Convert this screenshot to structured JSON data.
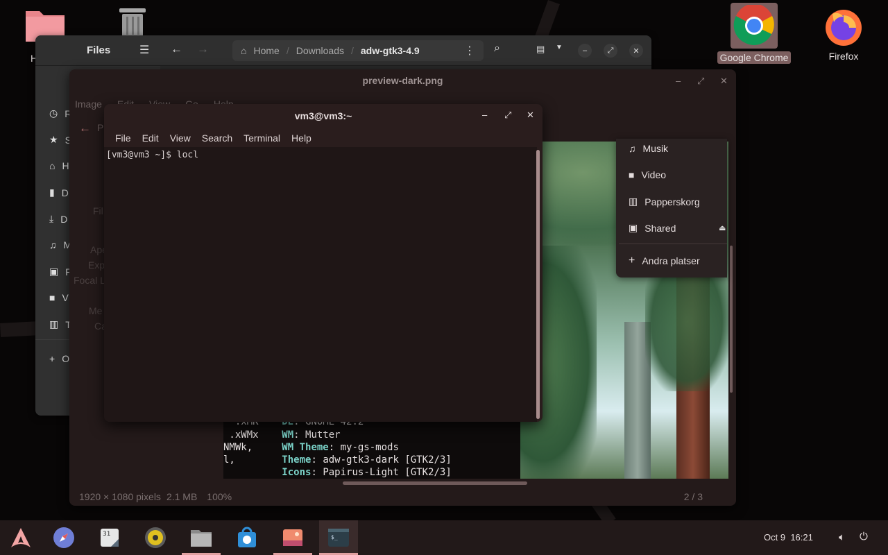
{
  "desktop": {
    "icons": [
      {
        "label": "H",
        "icon": "home-folder-icon"
      },
      {
        "label": "",
        "icon": "trash-icon"
      },
      {
        "label": "Google Chrome",
        "icon": "chrome-icon"
      },
      {
        "label": "Firefox",
        "icon": "firefox-icon"
      }
    ]
  },
  "files": {
    "title": "Files",
    "breadcrumb": [
      "Home",
      "Downloads",
      "adw-gtk3-4.9"
    ],
    "sidebar_letters": [
      "R",
      "S",
      "H",
      "D",
      "D",
      "M",
      "P",
      "V",
      "T",
      "O"
    ]
  },
  "image_viewer": {
    "title": "preview-dark.png",
    "menu": [
      "Image",
      "Edit",
      "View",
      "Go",
      "Help"
    ],
    "status": {
      "dimensions": "1920 × 1080 pixels",
      "size": "2.1 MB",
      "zoom": "100%"
    },
    "page": "2 / 3",
    "ghost_labels": [
      "P",
      "Fil",
      "Ape",
      "Exp",
      "Focal L",
      "Me",
      "Ca"
    ]
  },
  "places_popup": {
    "items": [
      {
        "label": "Musik",
        "icon": "music-note-icon"
      },
      {
        "label": "Video",
        "icon": "video-camera-icon"
      },
      {
        "label": "Papperskorg",
        "icon": "trash-icon"
      },
      {
        "label": "Shared",
        "icon": "shared-drive-icon"
      },
      {
        "label": "Andra platser",
        "icon": "plus-icon"
      }
    ]
  },
  "neofetch": {
    "rows": [
      {
        "art": "  .xMK  ",
        "key": "DE",
        "value": "GNOME 42.2"
      },
      {
        "art": " .xWMx  ",
        "key": "WM",
        "value": "Mutter"
      },
      {
        "art": "NMWk,   ",
        "key": "WM Theme",
        "value": "my-gs-mods"
      },
      {
        "art": "l,      ",
        "key": "Theme",
        "value": "adw-gtk3-dark [GTK2/3]"
      },
      {
        "art": "        ",
        "key": "Icons",
        "value": "Papirus-Light [GTK2/3]"
      }
    ]
  },
  "terminal": {
    "title": "vm3@vm3:~",
    "menu": [
      "File",
      "Edit",
      "View",
      "Search",
      "Terminal",
      "Help"
    ],
    "prompt": "[vm3@vm3 ~]$ locl"
  },
  "taskbar": {
    "apps": [
      "arch-logo-icon",
      "web-browser-icon",
      "calendar-icon",
      "music-player-icon",
      "files-icon",
      "software-store-icon",
      "image-viewer-icon",
      "terminal-icon"
    ],
    "date": "Oct 9",
    "time": "16:21"
  },
  "colors": {
    "accent": "#e0a0a0",
    "terminal_bg": "#1f1616"
  }
}
